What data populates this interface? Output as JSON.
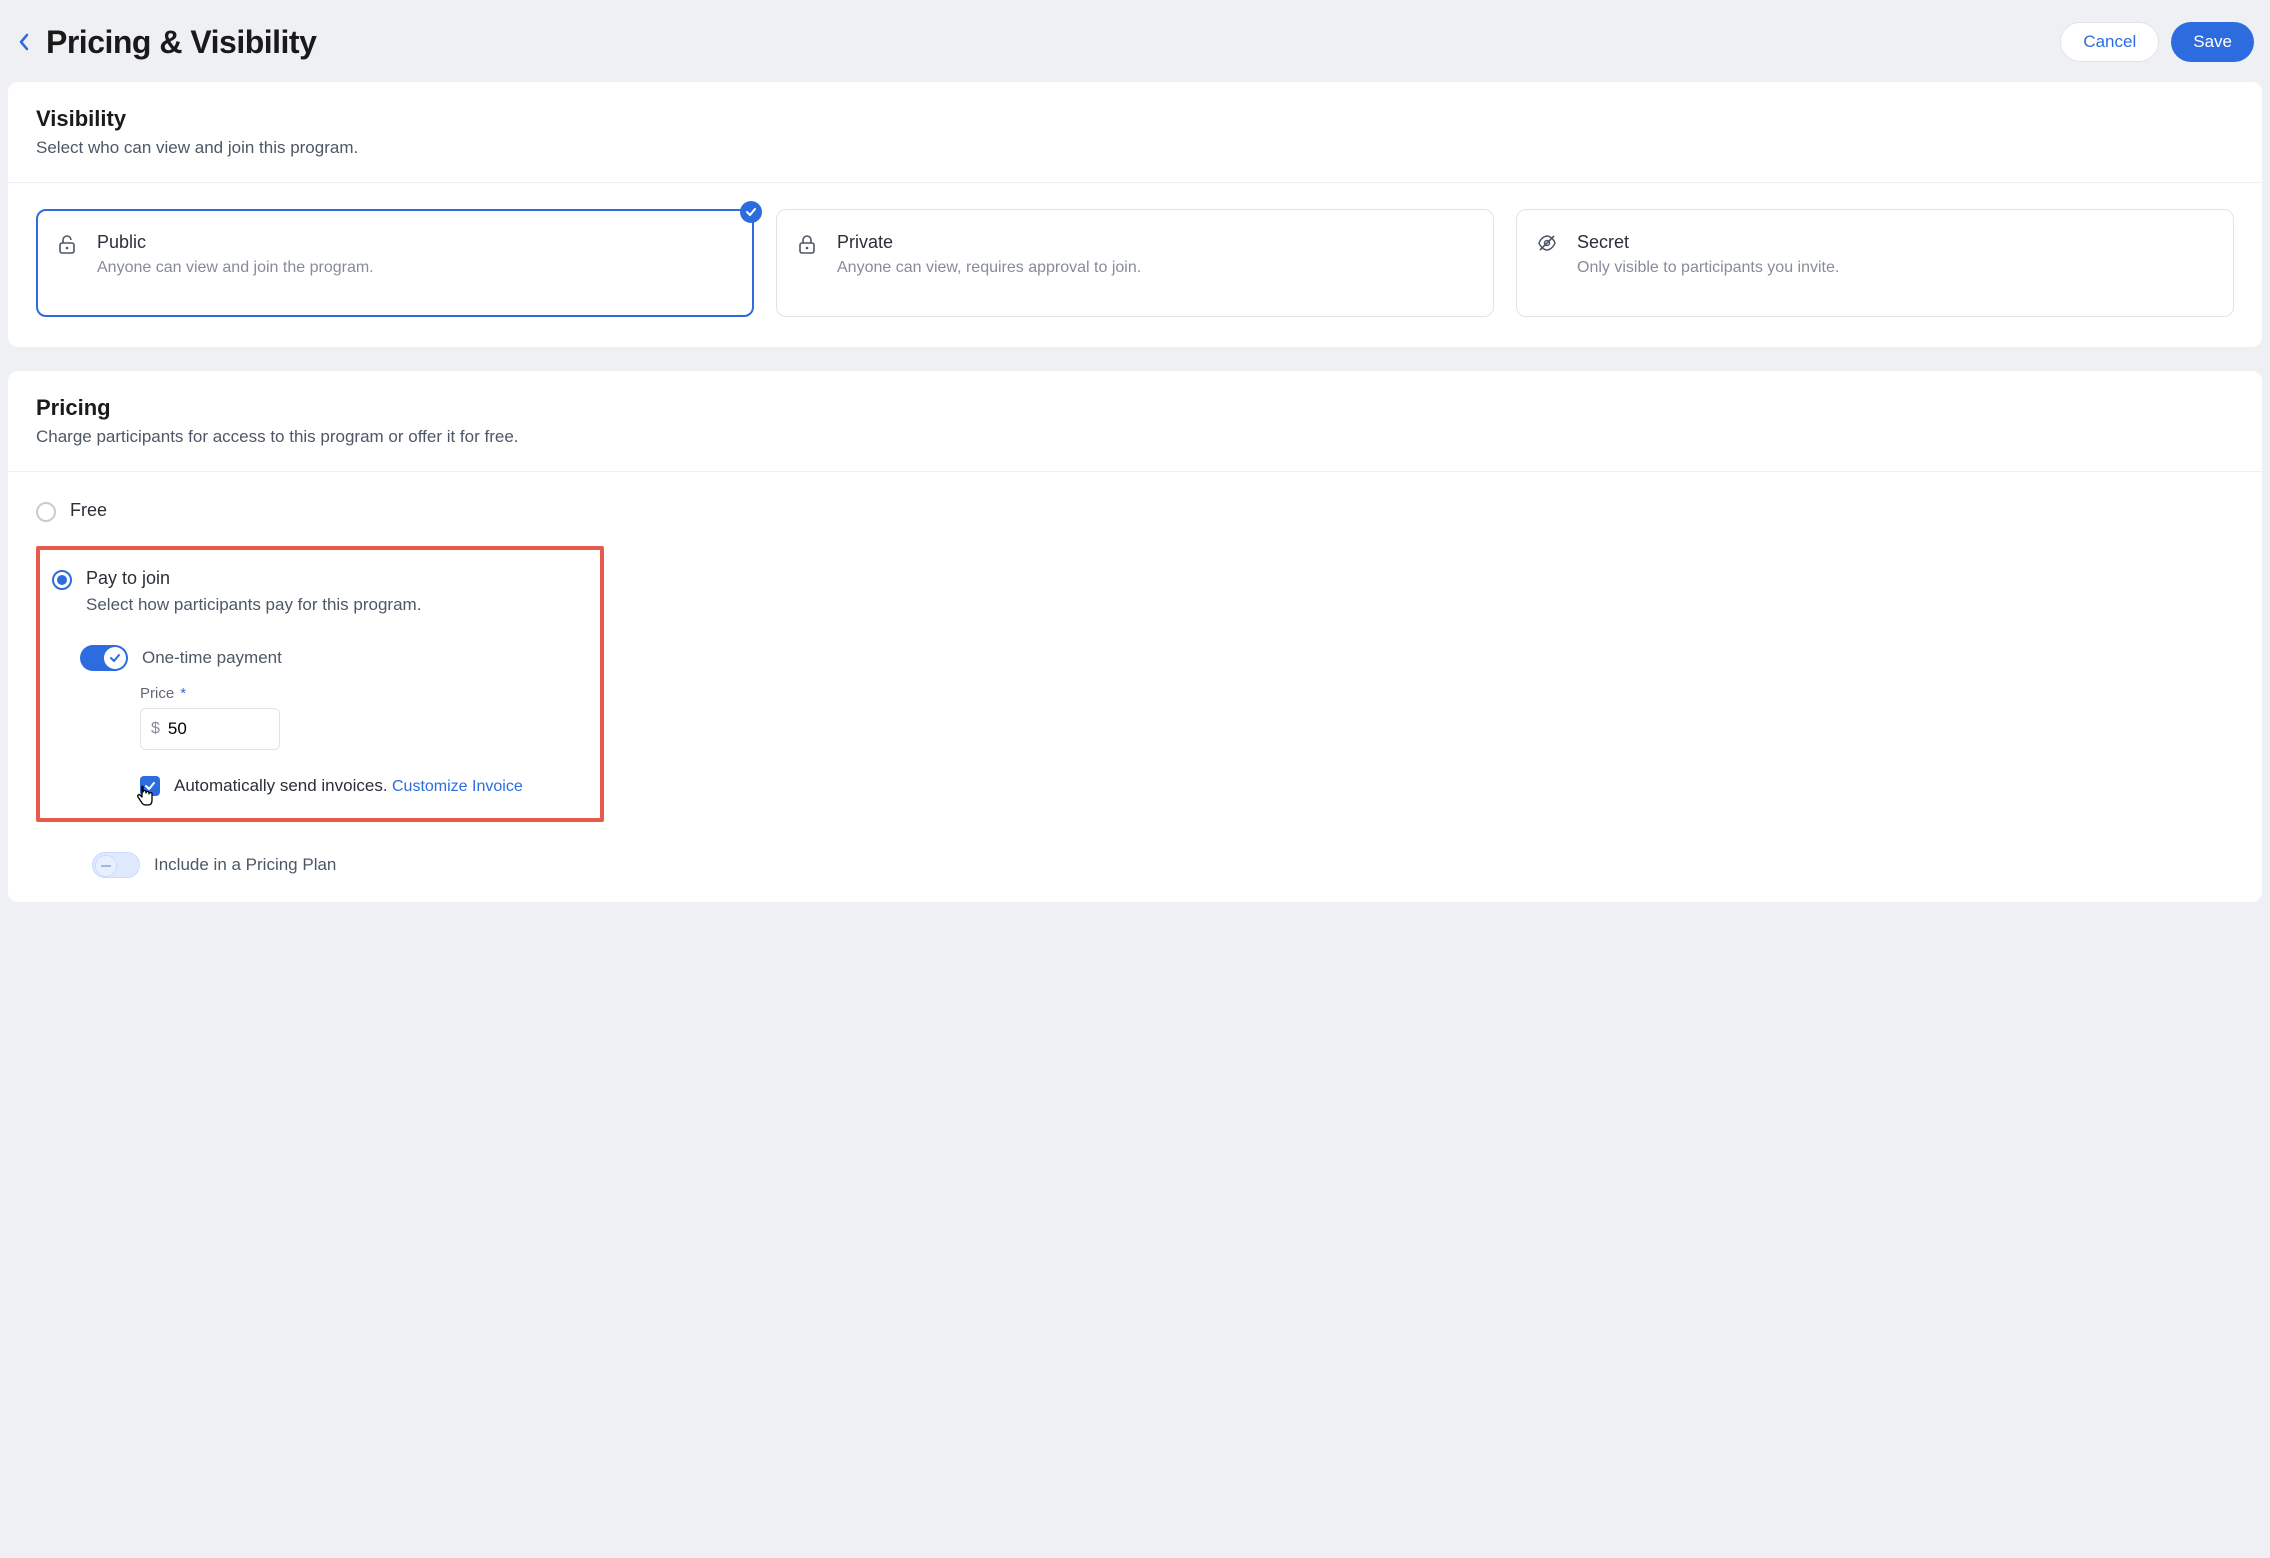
{
  "header": {
    "title": "Pricing & Visibility",
    "cancel": "Cancel",
    "save": "Save"
  },
  "visibility": {
    "title": "Visibility",
    "subtitle": "Select who can view and join this program.",
    "options": [
      {
        "title": "Public",
        "desc": "Anyone can view and join the program.",
        "selected": true
      },
      {
        "title": "Private",
        "desc": "Anyone can view, requires approval to join.",
        "selected": false
      },
      {
        "title": "Secret",
        "desc": "Only visible to participants you invite.",
        "selected": false
      }
    ]
  },
  "pricing": {
    "title": "Pricing",
    "subtitle": "Charge participants for access to this program or offer it for free.",
    "free_label": "Free",
    "pay_label": "Pay to join",
    "pay_sub": "Select how participants pay for this program.",
    "one_time_label": "One-time payment",
    "price_label": "Price",
    "currency": "$",
    "price_value": "50",
    "invoice_text": "Automatically send invoices.",
    "customize_link": "Customize Invoice",
    "plan_label": "Include in a Pricing Plan"
  }
}
